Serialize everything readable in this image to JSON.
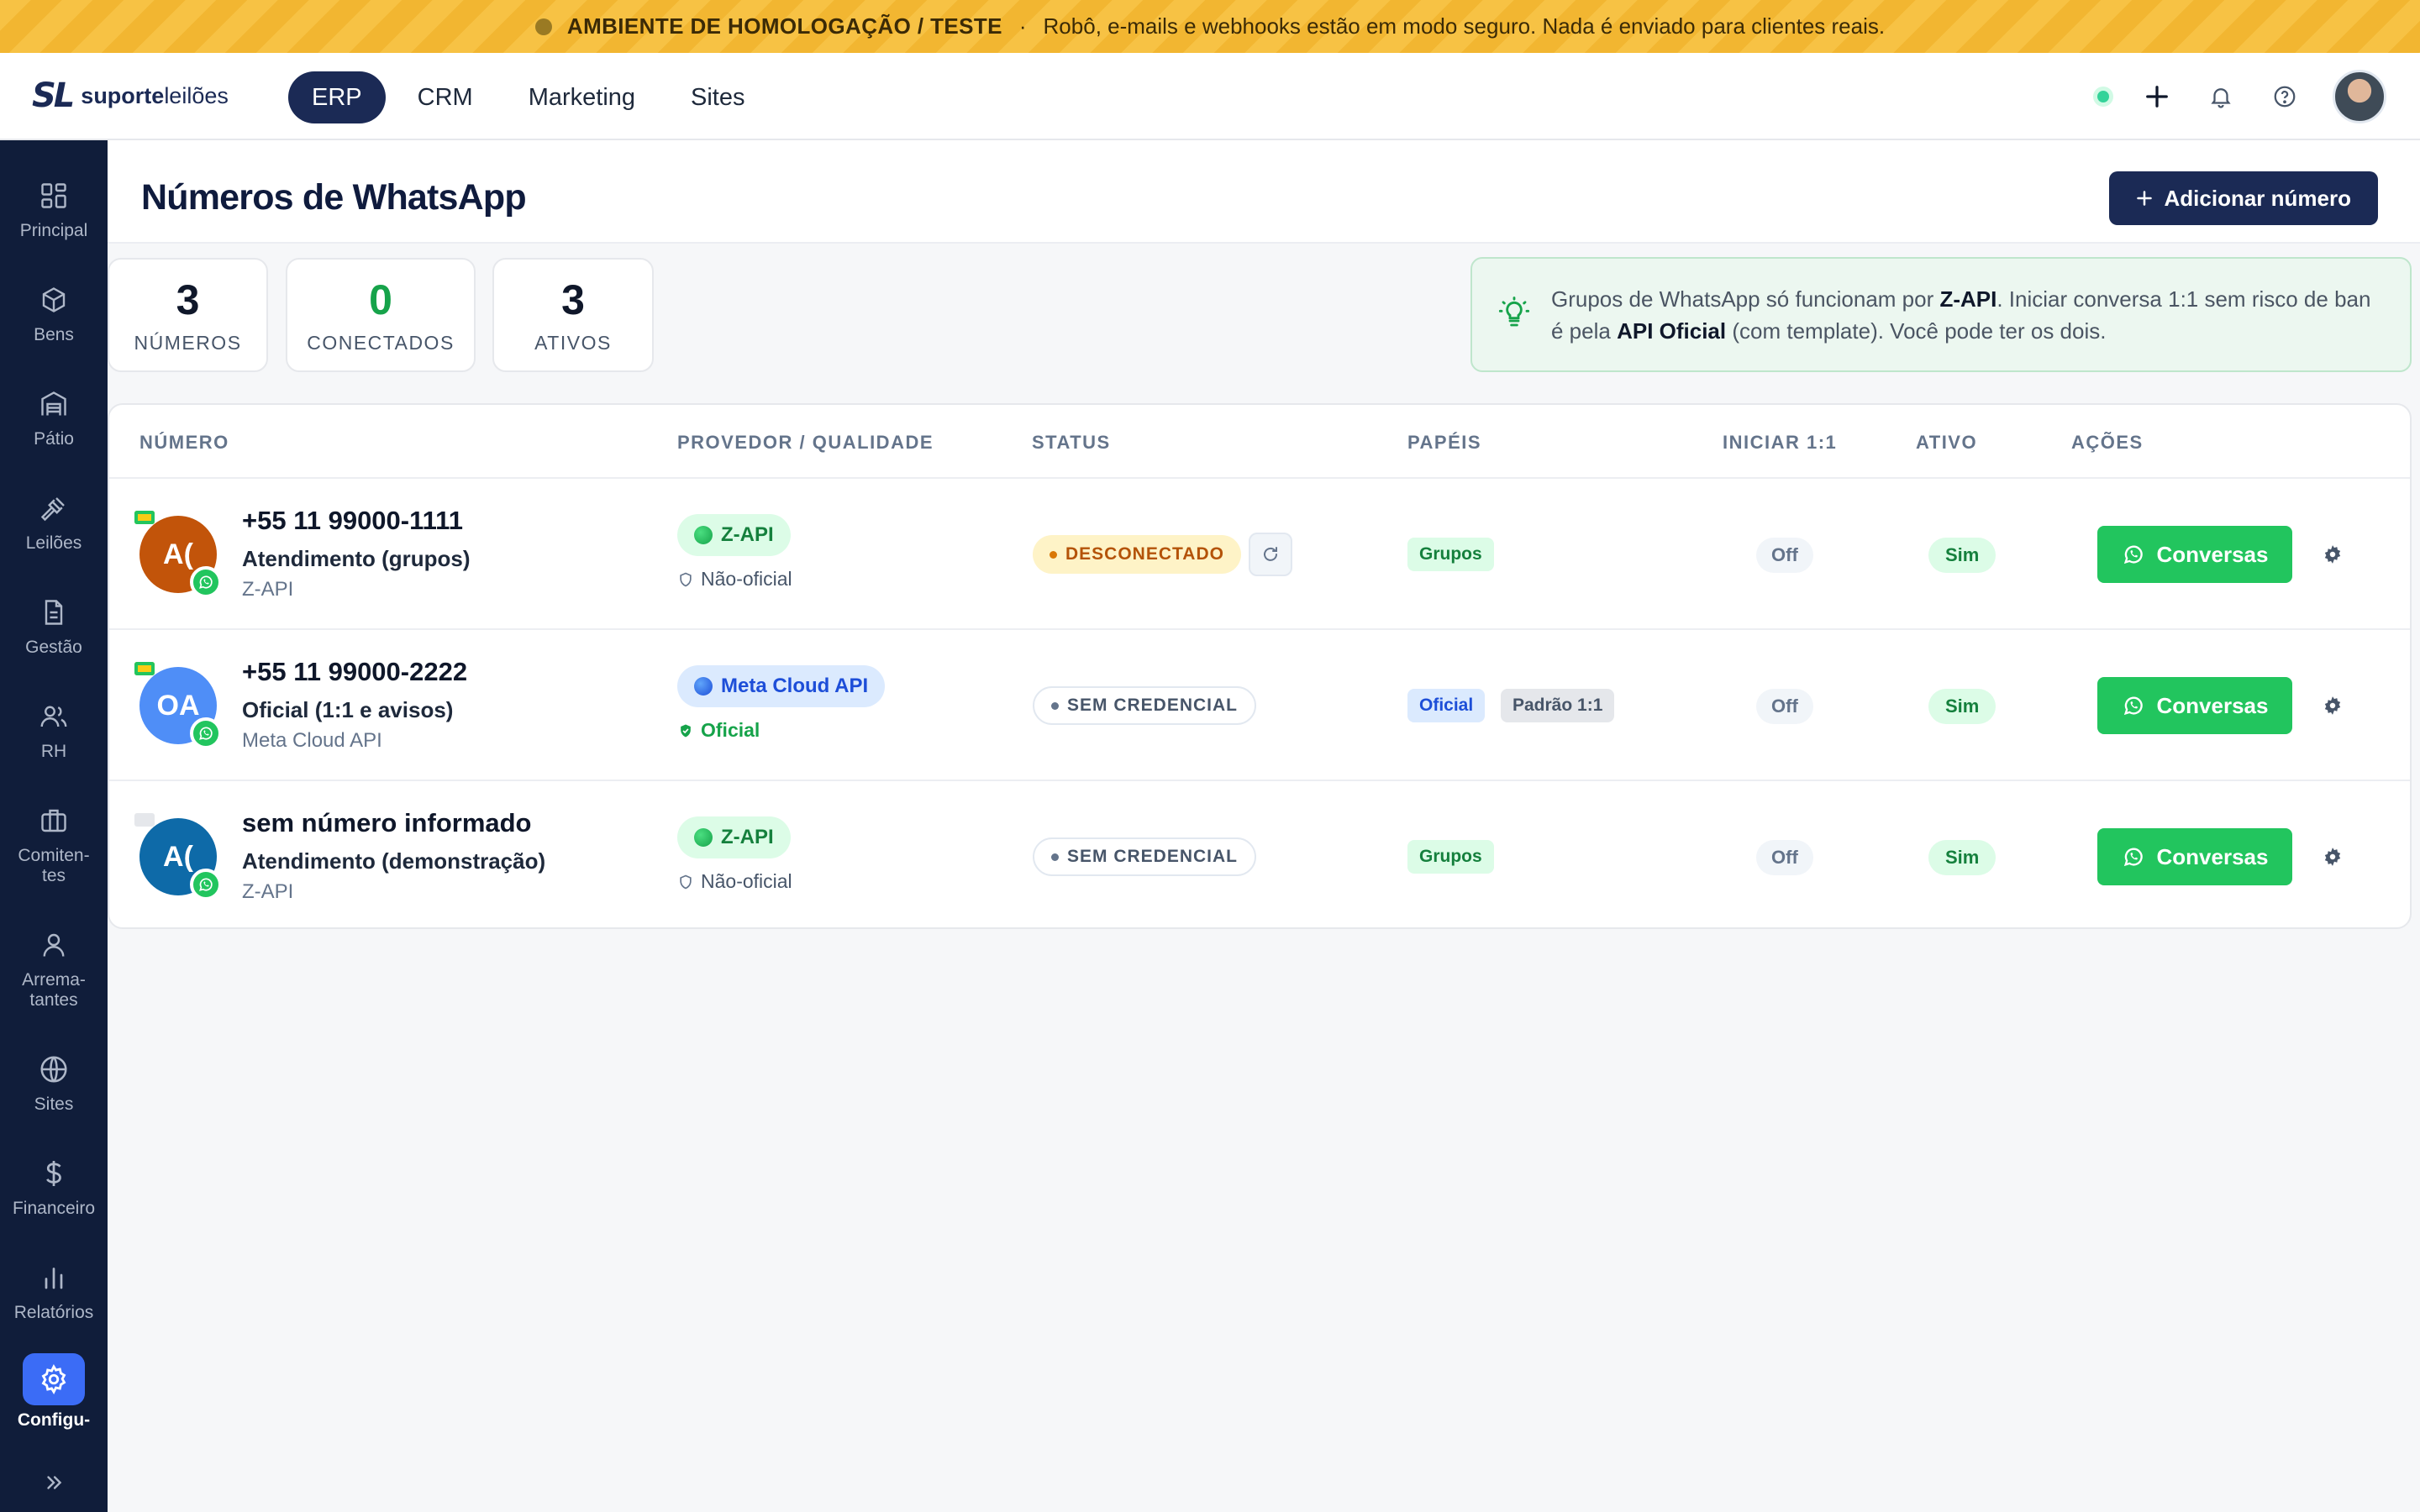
{
  "banner": {
    "title": "AMBIENTE DE HOMOLOGAÇÃO / TESTE",
    "separator": "·",
    "message": "Robô, e-mails e webhooks estão em modo seguro. Nada é enviado para clientes reais."
  },
  "brand": {
    "mark": "SL",
    "name_bold": "suporte",
    "name_light": "leilões"
  },
  "nav": {
    "tabs": [
      {
        "label": "ERP",
        "active": true
      },
      {
        "label": "CRM"
      },
      {
        "label": "Marketing"
      },
      {
        "label": "Sites"
      }
    ]
  },
  "sidebar": {
    "items": [
      {
        "label": "Principal",
        "icon": "dashboard-icon"
      },
      {
        "label": "Bens",
        "icon": "box-icon"
      },
      {
        "label": "Pátio",
        "icon": "warehouse-icon"
      },
      {
        "label": "Leilões",
        "icon": "gavel-icon"
      },
      {
        "label": "Gestão",
        "icon": "document-icon"
      },
      {
        "label": "RH",
        "icon": "people-icon"
      },
      {
        "label": "Comiten-\ntes",
        "icon": "briefcase-icon"
      },
      {
        "label": "Arrema-\ntantes",
        "icon": "user-icon"
      },
      {
        "label": "Sites",
        "icon": "globe-icon"
      },
      {
        "label": "Financeiro",
        "icon": "dollar-icon"
      },
      {
        "label": "Relatórios",
        "icon": "bar-chart-icon"
      },
      {
        "label": "Configu-",
        "icon": "settings-icon",
        "active": true
      }
    ]
  },
  "page": {
    "title": "Números de WhatsApp",
    "add_button": "Adicionar número"
  },
  "stats": [
    {
      "value": "3",
      "caption": "NÚMEROS"
    },
    {
      "value": "0",
      "caption": "CONECTADOS"
    },
    {
      "value": "3",
      "caption": "ATIVOS"
    }
  ],
  "tip": {
    "part1": "Grupos de WhatsApp só funcionam por ",
    "bold1": "Z-API",
    "part2": ". Iniciar conversa 1:1 sem risco de ban é pela ",
    "bold2": "API Oficial",
    "part3": " (com template). Você pode ter os dois."
  },
  "table": {
    "headers": [
      "NÚMERO",
      "PROVEDOR / QUALIDADE",
      "STATUS",
      "PAPÉIS",
      "INICIAR 1:1",
      "ATIVO",
      "AÇÕES"
    ],
    "rows": [
      {
        "initials": "A(",
        "avatar_color": "#c2540a",
        "phone": "+55 11 99000-1111",
        "label": "Atendimento (grupos)",
        "provider_small": "Z-API",
        "provider": "Z-API",
        "quality": "Não-oficial",
        "status": "DESCONECTADO",
        "roles": [
          "Grupos"
        ],
        "iniciar": "Off",
        "ativo": "Sim",
        "action": "Conversas"
      },
      {
        "initials": "OA",
        "avatar_color": "#4f8ef7",
        "phone": "+55 11 99000-2222",
        "label": "Oficial (1:1 e avisos)",
        "provider_small": "Meta Cloud API",
        "provider": "Meta Cloud API",
        "quality": "Oficial",
        "status": "SEM CREDENCIAL",
        "roles": [
          "Oficial",
          "Padrão 1:1"
        ],
        "iniciar": "Off",
        "ativo": "Sim",
        "action": "Conversas"
      },
      {
        "initials": "A(",
        "avatar_color": "#0e6aa8",
        "phone": "sem número informado",
        "label": "Atendimento (demonstração)",
        "provider_small": "Z-API",
        "provider": "Z-API",
        "quality": "Não-oficial",
        "status": "SEM CREDENCIAL",
        "roles": [
          "Grupos"
        ],
        "iniciar": "Off",
        "ativo": "Sim",
        "action": "Conversas"
      }
    ]
  }
}
